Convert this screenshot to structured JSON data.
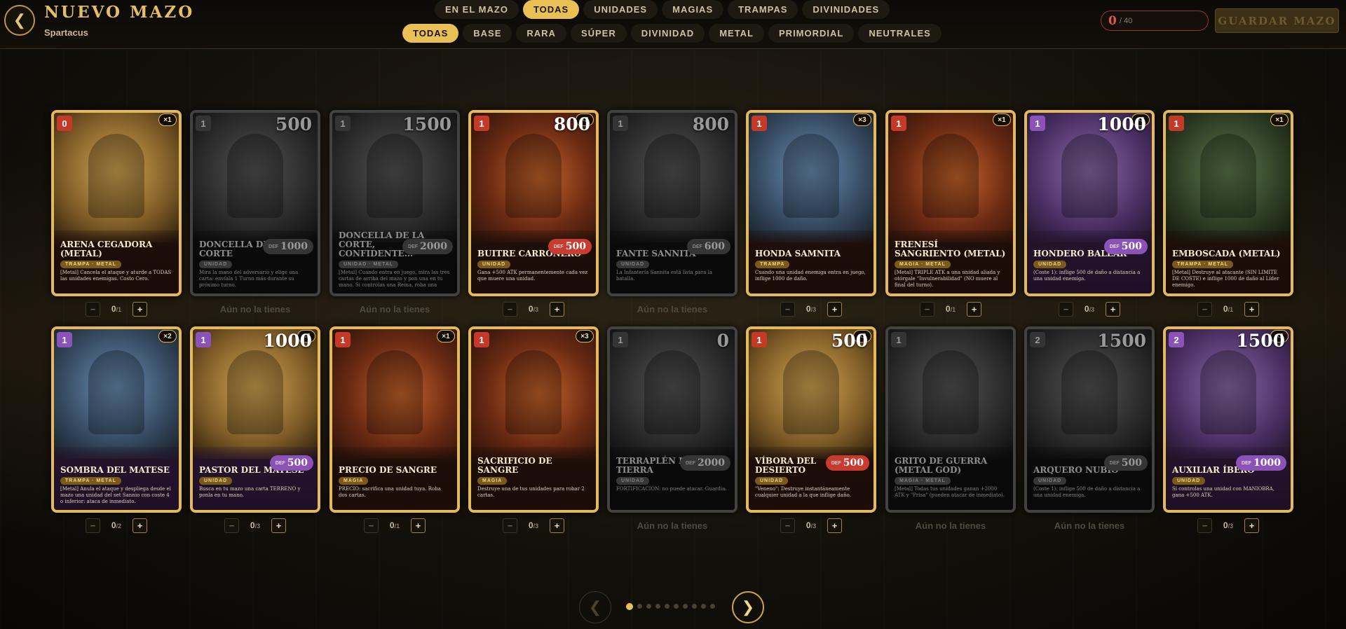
{
  "header": {
    "back_icon": "chevron-left-icon",
    "title": "NUEVO MAZO",
    "subtitle": "Spartacus",
    "counter_value": "0",
    "counter_total": "/ 40",
    "save_label": "GUARDAR MAZO"
  },
  "type_tabs": [
    {
      "label": "EN EL MAZO",
      "active": false
    },
    {
      "label": "TODAS",
      "active": true
    },
    {
      "label": "UNIDADES",
      "active": false
    },
    {
      "label": "MAGIAS",
      "active": false
    },
    {
      "label": "TRAMPAS",
      "active": false
    },
    {
      "label": "DIVINIDADES",
      "active": false
    }
  ],
  "rarity_tabs": [
    {
      "label": "TODAS",
      "active": true
    },
    {
      "label": "BASE",
      "active": false
    },
    {
      "label": "RARA",
      "active": false
    },
    {
      "label": "SÚPER",
      "active": false
    },
    {
      "label": "DIVINIDAD",
      "active": false
    },
    {
      "label": "METAL",
      "active": false
    },
    {
      "label": "PRIMORDIAL",
      "active": false
    },
    {
      "label": "NEUTRALES",
      "active": false
    }
  ],
  "not_owned_text": "Aún no la tienes",
  "cards": [
    {
      "name": "ARENA CEGADORA (METAL)",
      "cost": "0",
      "cost_color": "red",
      "copies": "×1",
      "atk": "",
      "def": "",
      "type": "TRAMPA · METAL",
      "desc": "[Metal] Cancela el ataque y aturde a TODAS las unidades enemigas. Costo Cero.",
      "owned": true,
      "count": "0",
      "max": "1",
      "art": "gold"
    },
    {
      "name": "DONCELLA DE LA CORTE",
      "cost": "1",
      "cost_color": "red",
      "copies": "",
      "atk": "500",
      "def": "1000",
      "type": "UNIDAD",
      "desc": "Mira la mano del adversario y elige una carta: envíala 1 Turno más durante su próximo turno.",
      "owned": false,
      "count": "",
      "max": "",
      "art": "gray"
    },
    {
      "name": "DONCELLA DE LA CORTE, CONFIDENTE...",
      "cost": "1",
      "cost_color": "red",
      "copies": "",
      "atk": "1500",
      "def": "2000",
      "type": "UNIDAD · METAL",
      "desc": "[Metal] Cuando entra en juego, mira las tres cartas de arriba del mazo y pon una en tu mano. Si controlas una Reina, roba una carta en tu turno.",
      "owned": false,
      "count": "",
      "max": "",
      "art": "gray"
    },
    {
      "name": "BUITRE CARROÑERO",
      "cost": "1",
      "cost_color": "red",
      "copies": "×3",
      "atk": "800",
      "def": "500",
      "type": "UNIDAD",
      "desc": "Gana +500 ATK permanentemente cada vez que muere una unidad.",
      "owned": true,
      "count": "0",
      "max": "3",
      "art": "red"
    },
    {
      "name": "FANTE SANNITA",
      "cost": "1",
      "cost_color": "red",
      "copies": "",
      "atk": "800",
      "def": "600",
      "type": "UNIDAD",
      "desc": "La Infantería Sannita está lista para la batalla.",
      "owned": false,
      "count": "",
      "max": "",
      "art": "gray"
    },
    {
      "name": "HONDA SAMNITA",
      "cost": "1",
      "cost_color": "red",
      "copies": "×3",
      "atk": "",
      "def": "",
      "type": "TRAMPA",
      "desc": "Cuando una unidad enemiga entra en juego, inflige 1000 de daño.",
      "owned": true,
      "count": "0",
      "max": "3",
      "art": "blue"
    },
    {
      "name": "FRENESÍ SANGRIENTO (METAL)",
      "cost": "1",
      "cost_color": "red",
      "copies": "×1",
      "atk": "",
      "def": "",
      "type": "MAGIA · METAL",
      "desc": "[Metal] TRIPLE ATK a una unidad aliada y otórgale \"Invulnerabilidad\" (NO muere al final del turno).",
      "owned": true,
      "count": "0",
      "max": "1",
      "art": "red"
    },
    {
      "name": "HONDERO BALEAR",
      "cost": "1",
      "cost_color": "purple",
      "copies": "×3",
      "atk": "1000",
      "def": "500",
      "type": "UNIDAD",
      "desc": "(Coste 1): inflige 500 de daño a distancia a una unidad enemiga.",
      "owned": true,
      "count": "0",
      "max": "3",
      "art": "purple"
    },
    {
      "name": "EMBOSCADA (METAL)",
      "cost": "1",
      "cost_color": "red",
      "copies": "×1",
      "atk": "",
      "def": "",
      "type": "TRAMPA · METAL",
      "desc": "[Metal] Destruye al atacante (SIN LÍMITE DE COSTE) e inflige 1000 de daño al Líder enemigo.",
      "owned": true,
      "count": "0",
      "max": "1",
      "art": "green"
    },
    {
      "name": "SOMBRA DEL MATESE",
      "cost": "1",
      "cost_color": "purple",
      "copies": "×2",
      "atk": "",
      "def": "",
      "type": "TRAMPA · METAL",
      "desc": "[Metal] Anula el ataque y despliega desde el mazo una unidad del set Sannio con coste 4 o inferior: ataca de inmediato.",
      "owned": true,
      "count": "0",
      "max": "2",
      "art": "blue"
    },
    {
      "name": "PASTOR DEL MATESE",
      "cost": "1",
      "cost_color": "purple",
      "copies": "×6",
      "atk": "1000",
      "def": "500",
      "type": "UNIDAD",
      "desc": "Busca en tu mazo una carta TERRENO y ponla en tu mano.",
      "owned": true,
      "count": "0",
      "max": "3",
      "art": "gold"
    },
    {
      "name": "PRECIO DE SANGRE",
      "cost": "1",
      "cost_color": "red",
      "copies": "×1",
      "atk": "",
      "def": "",
      "type": "MAGIA",
      "desc": "PRECIO: sacrifica una unidad tuya. Roba dos cartas.",
      "owned": true,
      "count": "0",
      "max": "1",
      "art": "red"
    },
    {
      "name": "SACRIFICIO DE SANGRE",
      "cost": "1",
      "cost_color": "red",
      "copies": "×3",
      "atk": "",
      "def": "",
      "type": "MAGIA",
      "desc": "Destruye una de tus unidades para robar 2 cartas.",
      "owned": true,
      "count": "0",
      "max": "3",
      "art": "red"
    },
    {
      "name": "TERRAPLÉN DE TIERRA",
      "cost": "1",
      "cost_color": "red",
      "copies": "",
      "atk": "0",
      "def": "2000",
      "type": "UNIDAD",
      "desc": "FORTIFICACIÓN: no puede atacar. Guardia.",
      "owned": false,
      "count": "",
      "max": "",
      "art": "gray"
    },
    {
      "name": "VÍBORA DEL DESIERTO",
      "cost": "1",
      "cost_color": "red",
      "copies": "×3",
      "atk": "500",
      "def": "500",
      "type": "UNIDAD",
      "desc": "\"Veneno\": Destruye instantáneamente cualquier unidad a la que inflige daño.",
      "owned": true,
      "count": "0",
      "max": "3",
      "art": "gold"
    },
    {
      "name": "GRITO DE GUERRA (METAL GOD)",
      "cost": "1",
      "cost_color": "red",
      "copies": "",
      "atk": "",
      "def": "",
      "type": "MAGIA · METAL",
      "desc": "[Metal] Todas tus unidades ganan +2000 ATK y \"Prisa\" (pueden atacar de inmediato).",
      "owned": false,
      "count": "",
      "max": "",
      "art": "gray"
    },
    {
      "name": "ARQUERO NUBIO",
      "cost": "2",
      "cost_color": "red",
      "copies": "",
      "atk": "1500",
      "def": "500",
      "type": "UNIDAD",
      "desc": "(Coste 1): inflige 500 de daño a distancia a una unidad enemiga.",
      "owned": false,
      "count": "",
      "max": "",
      "art": "gray"
    },
    {
      "name": "AUXILIAR ÍBERO",
      "cost": "2",
      "cost_color": "purple",
      "copies": "×3",
      "atk": "1500",
      "def": "1000",
      "type": "UNIDAD",
      "desc": "Si controlas una unidad con MANIOBRA, gana +500 ATK.",
      "owned": true,
      "count": "0",
      "max": "3",
      "art": "purple"
    }
  ],
  "pagination": {
    "pages": 10,
    "current": 1
  },
  "colors": {
    "accent": "#e8c055",
    "card_border": "#e3b95a",
    "cost_red": "#c43a28",
    "cost_purple": "#8b52b8"
  }
}
